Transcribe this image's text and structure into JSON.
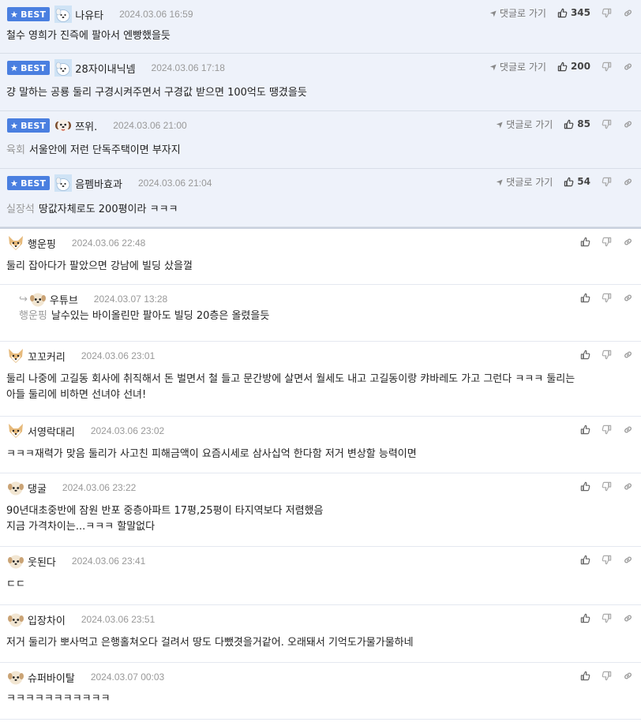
{
  "best_badge_label": "BEST",
  "goto_label": "댓글로 가기",
  "colors": {
    "badge_bg": "#4a7fe0",
    "best_row_bg": "#eef2fa",
    "mention": "#999999"
  },
  "comments": [
    {
      "best": true,
      "avatar": "white-dog-avatar",
      "nickname": "나유타",
      "date": "2024.03.06 16:59",
      "mention": "",
      "lines": [
        "철수 영희가 진즉에 팔아서 엔빵했을듯"
      ],
      "likes": "345"
    },
    {
      "best": true,
      "avatar": "white-dog-avatar",
      "nickname": "28자이내닉넴",
      "date": "2024.03.06 17:18",
      "mention": "",
      "lines": [
        "걍 말하는 공룡 둘리 구경시켜주면서 구경값 받으면 100억도 땡겼을듯"
      ],
      "likes": "200"
    },
    {
      "best": true,
      "avatar": "puppy-avatar",
      "nickname": "쯔위.",
      "date": "2024.03.06 21:00",
      "mention": "육회",
      "lines": [
        "서울안에 저런 단독주택이면 부자지"
      ],
      "likes": "85"
    },
    {
      "best": true,
      "avatar": "white-dog-avatar",
      "nickname": "음펨바효과",
      "date": "2024.03.06 21:04",
      "mention": "실장석",
      "lines": [
        "땅값자체로도 200평이라 ㅋㅋㅋ"
      ],
      "likes": "54"
    },
    {
      "best": false,
      "avatar": "fox-avatar",
      "nickname": "행운핑",
      "date": "2024.03.06 22:48",
      "mention": "",
      "lines": [
        "둘리 잡아다가 팔았으면 강남에 빌딩 샀을껄"
      ],
      "likes": ""
    },
    {
      "best": false,
      "reply": true,
      "avatar": "round-dog-avatar",
      "nickname": "우튜브",
      "date": "2024.03.07 13:28",
      "mention": "행운핑",
      "lines": [
        "날수있는 바이올린만 팔아도 빌딩 20층은 올렸을듯"
      ],
      "likes": ""
    },
    {
      "best": false,
      "avatar": "fox-avatar",
      "nickname": "꼬꼬커리",
      "date": "2024.03.06 23:01",
      "mention": "",
      "lines": [
        "둘리 나중에 고길동 회사에 취직해서 돈 벌면서 철 들고 문간방에 살면서 월세도 내고 고길동이랑 캬바레도 가고 그런다 ㅋㅋㅋ 둘리는",
        "아들 둘리에 비하면 선녀야 선녀!"
      ],
      "likes": ""
    },
    {
      "best": false,
      "avatar": "fox-avatar",
      "nickname": "서영락대리",
      "date": "2024.03.06 23:02",
      "mention": "",
      "lines": [
        "ㅋㅋㅋ재력가 맞음 둘리가 사고친 피해금액이 요즘시세로 삼사십억 한다함 저거 변상할 능력이면"
      ],
      "likes": ""
    },
    {
      "best": false,
      "avatar": "round-dog-avatar",
      "nickname": "댕굴",
      "date": "2024.03.06 23:22",
      "mention": "",
      "lines": [
        "90년대초중반에 잠원 반포 중층아파트 17평,25평이 타지역보다 저렴했음",
        "지금 가격차이는...ㅋㅋㅋ 할말없다"
      ],
      "likes": ""
    },
    {
      "best": false,
      "avatar": "round-dog-avatar",
      "nickname": "웃된다",
      "date": "2024.03.06 23:41",
      "mention": "",
      "lines": [
        "ㄷㄷ"
      ],
      "likes": ""
    },
    {
      "best": false,
      "avatar": "round-dog-avatar",
      "nickname": "입장차이",
      "date": "2024.03.06 23:51",
      "mention": "",
      "lines": [
        "저거 둘리가 뽀사먹고 은행홀쳐오다 걸려서 땅도 다뺐겻을거같어. 오래돼서 기억도가물가물하네"
      ],
      "likes": ""
    },
    {
      "best": false,
      "avatar": "round-dog-avatar",
      "nickname": "슈퍼바이탈",
      "date": "2024.03.07 00:03",
      "mention": "",
      "lines": [
        "ㅋㅋㅋㅋㅋㅋㅋㅋㅋㅋㅋ"
      ],
      "likes": ""
    }
  ]
}
